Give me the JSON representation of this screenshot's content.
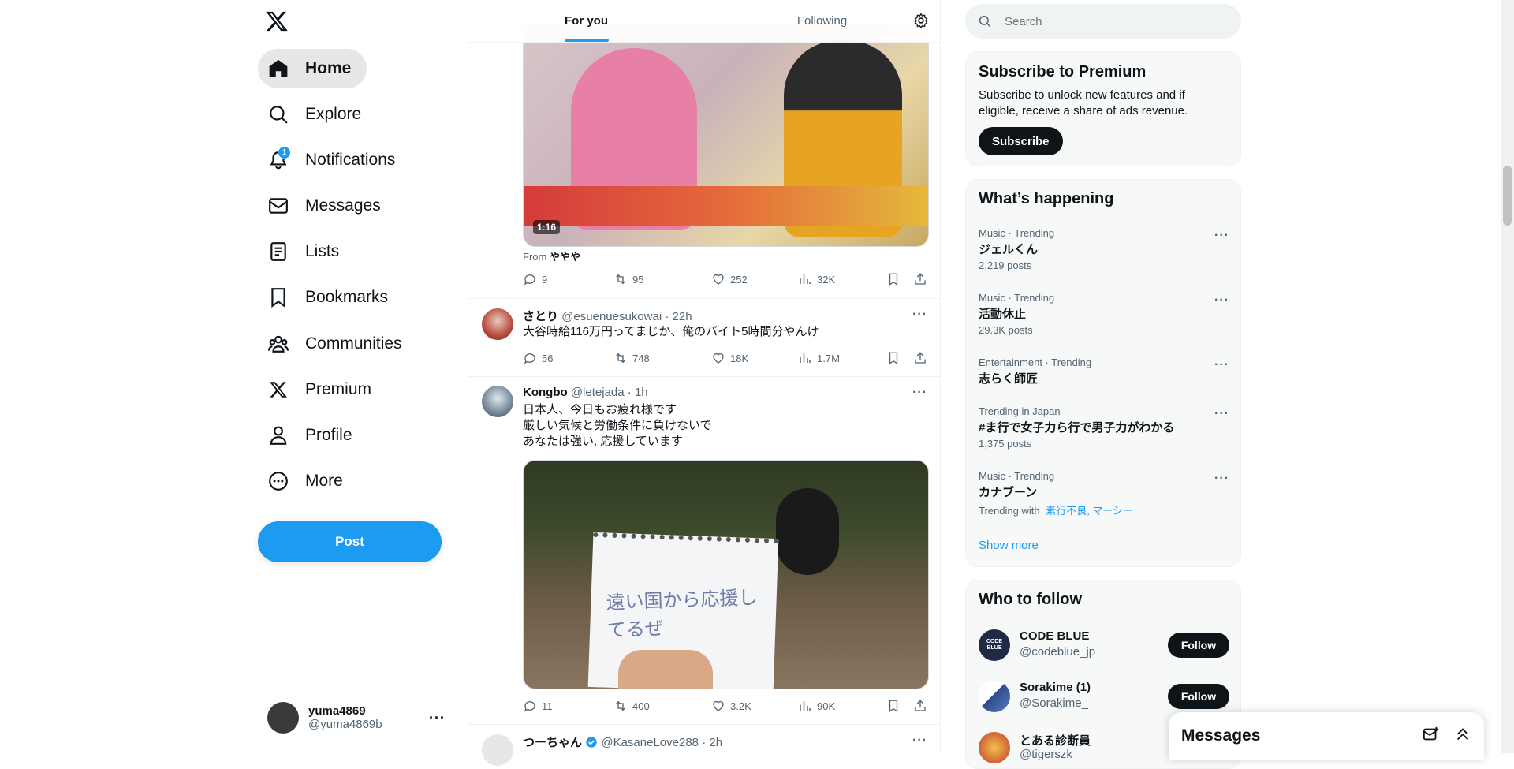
{
  "nav": {
    "items": [
      {
        "label": "Home",
        "icon": "home-icon"
      },
      {
        "label": "Explore",
        "icon": "search-icon"
      },
      {
        "label": "Notifications",
        "icon": "bell-icon"
      },
      {
        "label": "Messages",
        "icon": "envelope-icon"
      },
      {
        "label": "Lists",
        "icon": "list-icon"
      },
      {
        "label": "Bookmarks",
        "icon": "bookmark-icon"
      },
      {
        "label": "Communities",
        "icon": "people-icon"
      },
      {
        "label": "Premium",
        "icon": "x-logo-icon"
      },
      {
        "label": "Profile",
        "icon": "person-icon"
      },
      {
        "label": "More",
        "icon": "more-circle-icon"
      }
    ],
    "notification_badge": "1",
    "post_label": "Post"
  },
  "account": {
    "name": "yuma4869",
    "handle": "@yuma4869b"
  },
  "tabs": {
    "for_you": "For you",
    "following": "Following"
  },
  "feed": {
    "top_tweet": {
      "video_duration": "1:16",
      "source_prefix": "From",
      "source_name": "ややや",
      "replies": "9",
      "reposts": "95",
      "likes": "252",
      "views": "32K"
    },
    "tweet2": {
      "name": "さとり",
      "handle": "@esuenuesukowai",
      "time": "22h",
      "text": "大谷時給116万円ってまじか、俺のバイト5時間分やんけ",
      "replies": "56",
      "reposts": "748",
      "likes": "18K",
      "views": "1.7M"
    },
    "tweet3": {
      "name": "Kongbo",
      "handle": "@letejada",
      "time": "1h",
      "line1": "日本人、今日もお疲れ様です",
      "line2": "厳しい気候と労働条件に負けないで",
      "line3": "あなたは強い, 応援しています",
      "sign_text": "遠い国から応援してるぜ",
      "replies": "11",
      "reposts": "400",
      "likes": "3.2K",
      "views": "90K"
    },
    "tweet4": {
      "name": "つーちゃん",
      "handle": "@KasaneLove288",
      "time": "2h"
    }
  },
  "search": {
    "placeholder": "Search"
  },
  "premium": {
    "title": "Subscribe to Premium",
    "body": "Subscribe to unlock new features and if eligible, receive a share of ads revenue.",
    "button": "Subscribe"
  },
  "happening": {
    "title": "What’s happening",
    "trends": [
      {
        "category": "Music · Trending",
        "title": "ジェルくん",
        "count": "2,219 posts"
      },
      {
        "category": "Music · Trending",
        "title": "活動休止",
        "count": "29.3K posts"
      },
      {
        "category": "Entertainment · Trending",
        "title": "志らく師匠",
        "count": ""
      },
      {
        "category": "Trending in Japan",
        "title": "#ま行で女子力ら行で男子力がわかる",
        "count": "1,375 posts"
      },
      {
        "category": "Music · Trending",
        "title": "カナブーン",
        "count": ""
      }
    ],
    "trend5_with": "Trending with",
    "trend5_links": "素行不良, マーシー",
    "show_more": "Show more"
  },
  "who_to_follow": {
    "title": "Who to follow",
    "users": [
      {
        "name": "CODE BLUE",
        "handle": "@codeblue_jp",
        "button": "Follow"
      },
      {
        "name": "Sorakime (1)",
        "handle": "@Sorakime_",
        "button": "Follow"
      },
      {
        "name": "とある診断員",
        "handle": "@tigerszk"
      }
    ],
    "codeblue_logo": "CODE BLUE"
  },
  "messages_drawer": {
    "title": "Messages"
  },
  "colors": {
    "accent": "#1d9bf0",
    "text": "#0f1419",
    "muted": "#536471"
  }
}
